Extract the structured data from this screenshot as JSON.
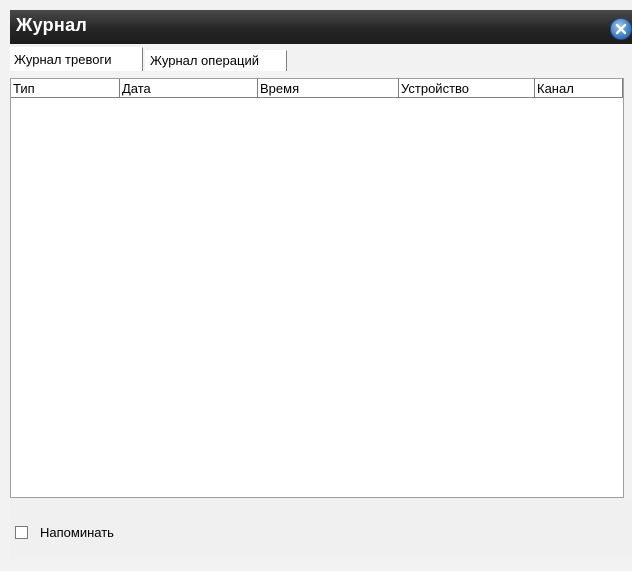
{
  "window": {
    "title": "Журнал",
    "close_icon": "close-icon"
  },
  "tabs": [
    {
      "label": "Журнал тревоги",
      "active": true
    },
    {
      "label": "Журнал операций",
      "active": false
    }
  ],
  "table": {
    "columns": [
      "Тип",
      "Дата",
      "Время",
      "Устройство",
      "Канал"
    ],
    "rows": []
  },
  "footer": {
    "remind_label": "Напоминать",
    "remind_checked": false
  },
  "colors": {
    "titlebar": "#262626",
    "close_button": "#3f7fc6",
    "background": "#f2f2f2"
  }
}
